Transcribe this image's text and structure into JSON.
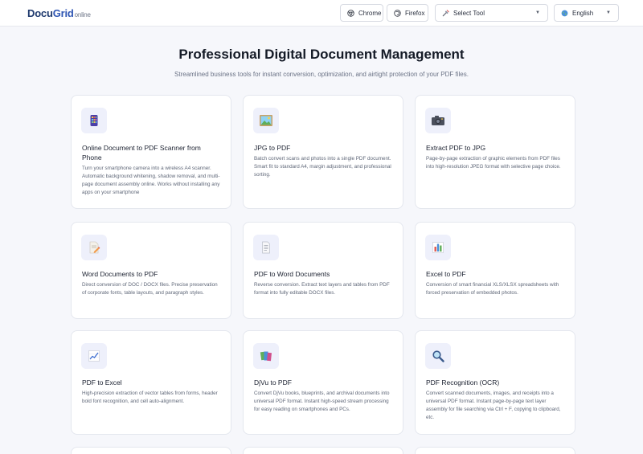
{
  "header": {
    "logo": {
      "main": "Docu",
      "accent": "Grid",
      "suffix": "online"
    },
    "chrome_label": "Chrome",
    "firefox_label": "Firefox",
    "tool_select": {
      "label": "Select Tool"
    },
    "language_select": {
      "label": "English"
    }
  },
  "hero": {
    "title": "Professional Digital Document Management",
    "subtitle": "Streamlined business tools for instant conversion, optimization, and airtight protection of your PDF files."
  },
  "tools": [
    {
      "title": "Online Document to PDF Scanner from Phone",
      "description": "Turn your smartphone camera into a wireless A4 scanner. Automatic background whitening, shadow removal, and multi-page document assembly online. Works without installing any apps on your smartphone",
      "icon": "phone-icon"
    },
    {
      "title": "JPG to PDF",
      "description": "Batch convert scans and photos into a single PDF document. Smart fit to standard A4, margin adjustment, and professional sorting.",
      "icon": "picture-icon"
    },
    {
      "title": "Extract PDF to JPG",
      "description": "Page-by-page extraction of graphic elements from PDF files into high-resolution JPEG format with selective page choice.",
      "icon": "camera-icon"
    },
    {
      "title": "Word Documents to PDF",
      "description": "Direct conversion of DOC / DOCX files. Precise preservation of corporate fonts, table layouts, and paragraph styles.",
      "icon": "document-pen-icon"
    },
    {
      "title": "PDF to Word Documents",
      "description": "Reverse conversion. Extract text layers and tables from PDF format into fully editable DOCX files.",
      "icon": "text-document-icon"
    },
    {
      "title": "Excel to PDF",
      "description": "Conversion of smart financial XLS/XLSX spreadsheets with forced preservation of embedded photos.",
      "icon": "bar-chart-icon"
    },
    {
      "title": "PDF to Excel",
      "description": "High-precision extraction of vector tables from forms, header bold font recognition, and cell auto-alignment.",
      "icon": "line-chart-icon"
    },
    {
      "title": "DjVu to PDF",
      "description": "Convert DjVu books, blueprints, and archival documents into universal PDF format. Instant high-speed stream processing for easy reading on smartphones and PCs.",
      "icon": "books-icon"
    },
    {
      "title": "PDF Recognition (OCR)",
      "description": "Convert scanned documents, images, and receipts into a universal PDF format. Instant page-by-page text layer assembly for file searching via Ctrl + F, copying to clipboard, etc.",
      "icon": "magnifier-icon"
    }
  ]
}
